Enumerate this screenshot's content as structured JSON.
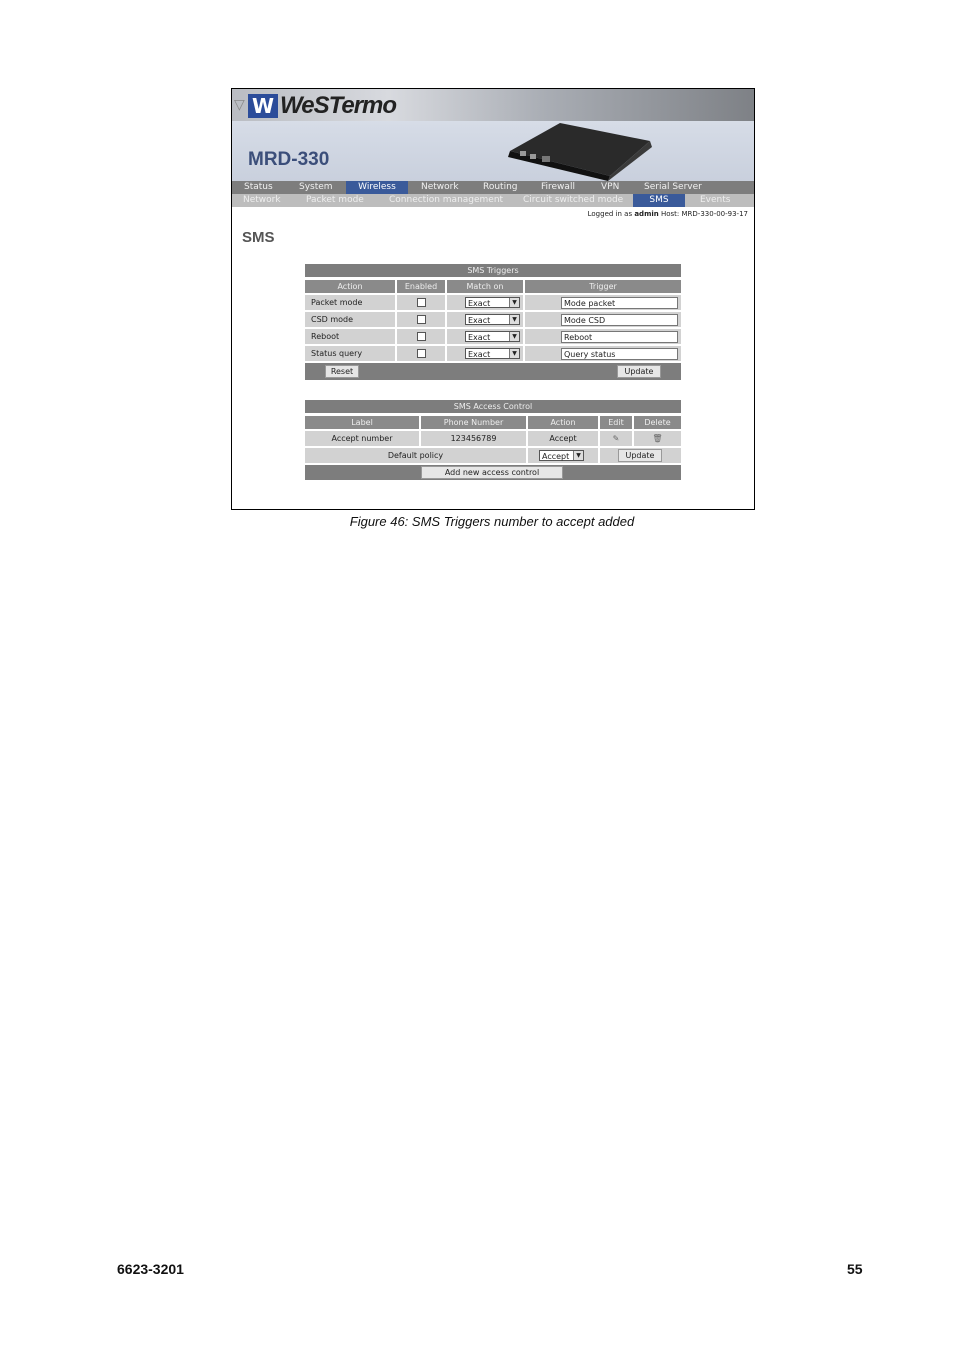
{
  "brand": {
    "logo_text": "WeSTermo",
    "model": "MRD-330"
  },
  "menu_primary": [
    {
      "label": "Status"
    },
    {
      "label": "System"
    },
    {
      "label": "Wireless"
    },
    {
      "label": "Network"
    },
    {
      "label": "Routing"
    },
    {
      "label": "Firewall"
    },
    {
      "label": "VPN"
    },
    {
      "label": "Serial Server"
    }
  ],
  "menu_secondary": [
    {
      "label": "Network"
    },
    {
      "label": "Packet mode"
    },
    {
      "label": "Connection management"
    },
    {
      "label": "Circuit switched mode"
    },
    {
      "label": "SMS"
    },
    {
      "label": "Events"
    }
  ],
  "login": {
    "prefix": "Logged in as",
    "user": "admin",
    "host_label": "Host:",
    "host": "MRD-330-00-93-17"
  },
  "page_title": "SMS",
  "triggers": {
    "title": "SMS Triggers",
    "columns": [
      "Action",
      "Enabled",
      "Match on",
      "Trigger"
    ],
    "rows": [
      {
        "action": "Packet mode",
        "match": "Exact",
        "trigger": "Mode packet"
      },
      {
        "action": "CSD mode",
        "match": "Exact",
        "trigger": "Mode CSD"
      },
      {
        "action": "Reboot",
        "match": "Exact",
        "trigger": "Reboot"
      },
      {
        "action": "Status query",
        "match": "Exact",
        "trigger": "Query status"
      }
    ],
    "reset_label": "Reset",
    "update_label": "Update"
  },
  "access": {
    "title": "SMS Access Control",
    "columns": [
      "Label",
      "Phone Number",
      "Action",
      "Edit",
      "Delete"
    ],
    "rows": [
      {
        "label": "Accept number",
        "phone": "123456789",
        "action": "Accept"
      }
    ],
    "default_policy_label": "Default policy",
    "default_policy_value": "Accept",
    "update_label": "Update",
    "add_label": "Add new access control"
  },
  "caption": "Figure 46: SMS Triggers number to accept added",
  "footer": {
    "doc_number": "6623-3201",
    "page_number": "55"
  }
}
